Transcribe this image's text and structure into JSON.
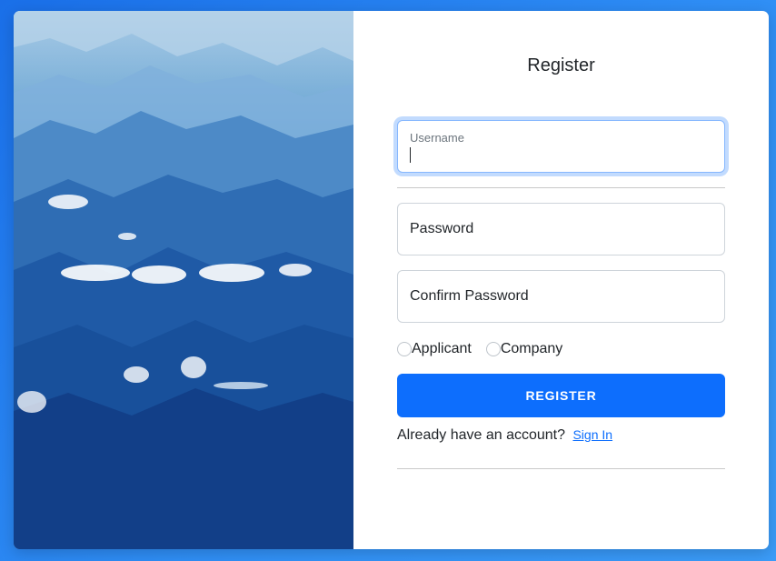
{
  "form": {
    "title": "Register",
    "username": {
      "label": "Username",
      "value": ""
    },
    "password": {
      "placeholder": "Password"
    },
    "confirm_password": {
      "placeholder": "Confirm Password"
    },
    "role_options": [
      "Applicant",
      "Company"
    ],
    "submit_label": "REGISTER",
    "signin_prompt": "Already have an account?",
    "signin_link": "Sign In"
  },
  "colors": {
    "background": "#2f8ef5",
    "primary": "#0d6efd",
    "link": "#0d6efd"
  }
}
